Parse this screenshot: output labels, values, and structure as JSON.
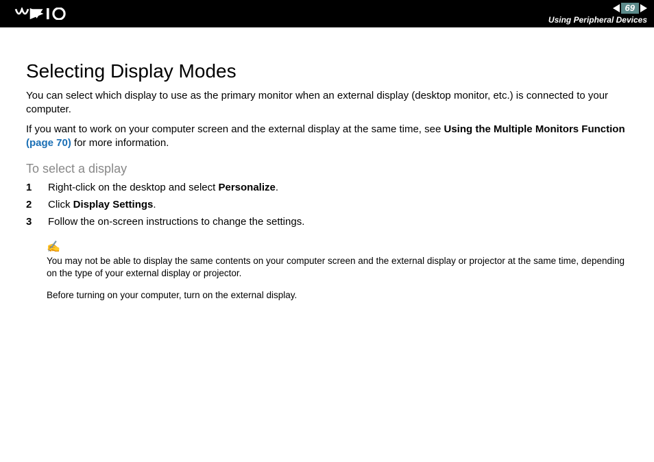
{
  "header": {
    "page_number": "69",
    "breadcrumb": "Using Peripheral Devices"
  },
  "main": {
    "title": "Selecting Display Modes",
    "p1": "You can select which display to use as the primary monitor when an external display (desktop monitor, etc.) is connected to your computer.",
    "p2_a": "If you want to work on your computer screen and the external display at the same time, see ",
    "p2_bold": "Using the Multiple Monitors Function",
    "p2_link": " (page 70)",
    "p2_c": " for more information.",
    "subheading": "To select a display",
    "steps": [
      {
        "n": "1",
        "pre": "Right-click on the desktop and select ",
        "bold": "Personalize",
        "post": "."
      },
      {
        "n": "2",
        "pre": "Click ",
        "bold": "Display Settings",
        "post": "."
      },
      {
        "n": "3",
        "pre": "Follow the on-screen instructions to change the settings.",
        "bold": "",
        "post": ""
      }
    ],
    "note_icon": "✍",
    "note1": "You may not be able to display the same contents on your computer screen and the external display or projector at the same time, depending on the type of your external display or projector.",
    "note2": "Before turning on your computer, turn on the external display."
  }
}
